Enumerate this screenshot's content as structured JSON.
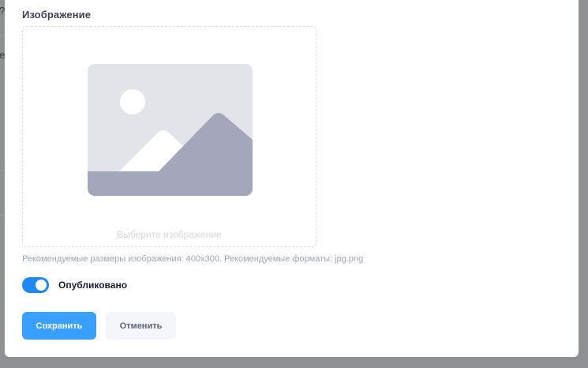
{
  "background": {
    "row_texts": [
      "?i",
      "e"
    ]
  },
  "image_field": {
    "label": "Изображение",
    "dropzone_hint": "Выберите изображение",
    "help_text": "Рекомендуемые размеры изображения: 400x300. Рекомендуемые форматы: jpg.png"
  },
  "published": {
    "label": "Опубликовано",
    "checked": true
  },
  "actions": {
    "save_label": "Сохранить",
    "cancel_label": "Отменить"
  },
  "colors": {
    "accent": "#3aa0ff",
    "toggle_on": "#1e88f5",
    "overlay": "#8e9092"
  },
  "icons": {
    "placeholder": "image-placeholder-icon"
  }
}
